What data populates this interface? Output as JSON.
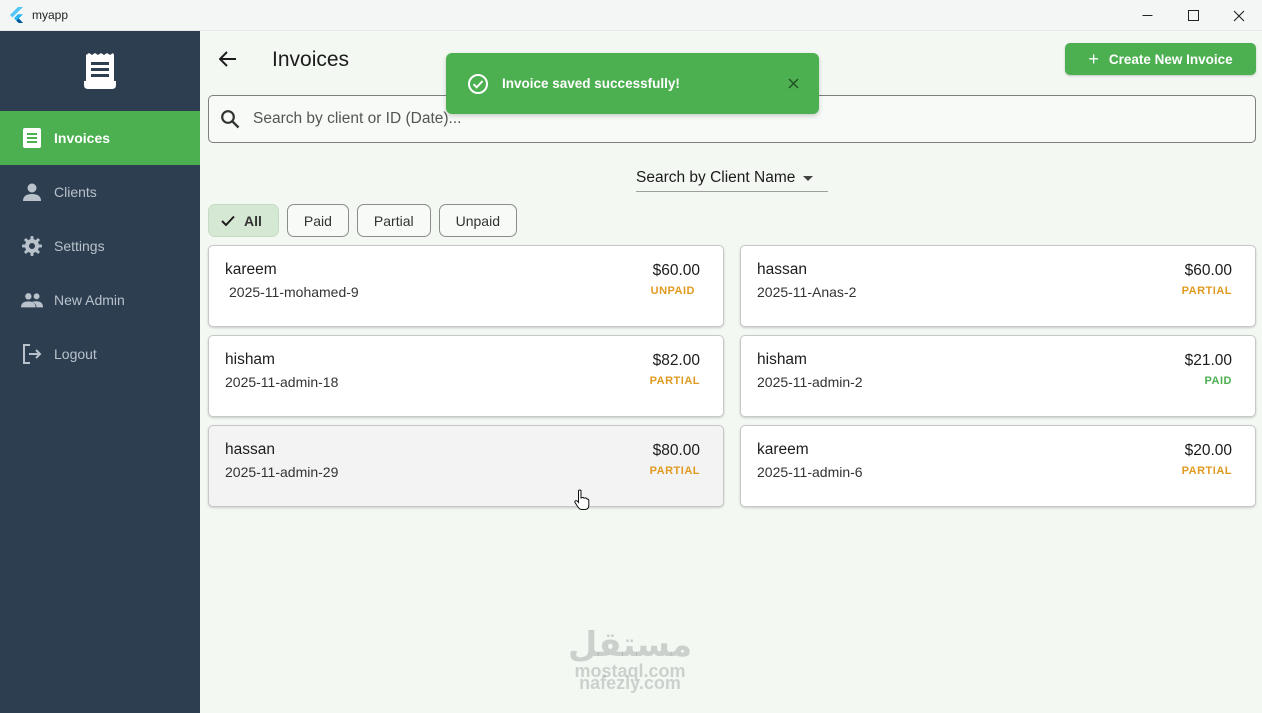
{
  "window": {
    "title": "myapp"
  },
  "sidebar": {
    "items": [
      {
        "label": "Invoices",
        "icon": "receipt-icon",
        "active": true
      },
      {
        "label": "Clients",
        "icon": "person-icon"
      },
      {
        "label": "Settings",
        "icon": "gear-icon"
      },
      {
        "label": "New Admin",
        "icon": "people-icon"
      },
      {
        "label": "Logout",
        "icon": "logout-icon"
      }
    ]
  },
  "header": {
    "title": "Invoices",
    "create_button": "Create New Invoice"
  },
  "search": {
    "placeholder": "Search by client or ID (Date)...",
    "value": ""
  },
  "search_mode": {
    "selected": "Search by Client Name"
  },
  "filters": [
    "All",
    "Paid",
    "Partial",
    "Unpaid"
  ],
  "invoices": [
    {
      "client": "kareem",
      "id": "2025-11-mohamed-9",
      "amount": "$60.00",
      "status": "UNPAID"
    },
    {
      "client": "hassan",
      "id": "2025-11-Anas-2",
      "amount": "$60.00",
      "status": "PARTIAL"
    },
    {
      "client": "hisham",
      "id": "2025-11-admin-18",
      "amount": "$82.00",
      "status": "PARTIAL"
    },
    {
      "client": "hisham",
      "id": "2025-11-admin-2",
      "amount": "$21.00",
      "status": "PAID"
    },
    {
      "client": "hassan",
      "id": "2025-11-admin-29",
      "amount": "$80.00",
      "status": "PARTIAL"
    },
    {
      "client": "kareem",
      "id": "2025-11-admin-6",
      "amount": "$20.00",
      "status": "PARTIAL"
    }
  ],
  "toast": {
    "message": "Invoice saved successfully!"
  },
  "watermark": {
    "arabic": "مستقل",
    "line1": "mostaql.com",
    "line2": "nafezly.com"
  },
  "colors": {
    "accent": "#4caf50",
    "sidebar": "#2c3e50",
    "unpaid": "#e09a1f",
    "partial": "#e09a1f",
    "paid": "#4caf50"
  }
}
